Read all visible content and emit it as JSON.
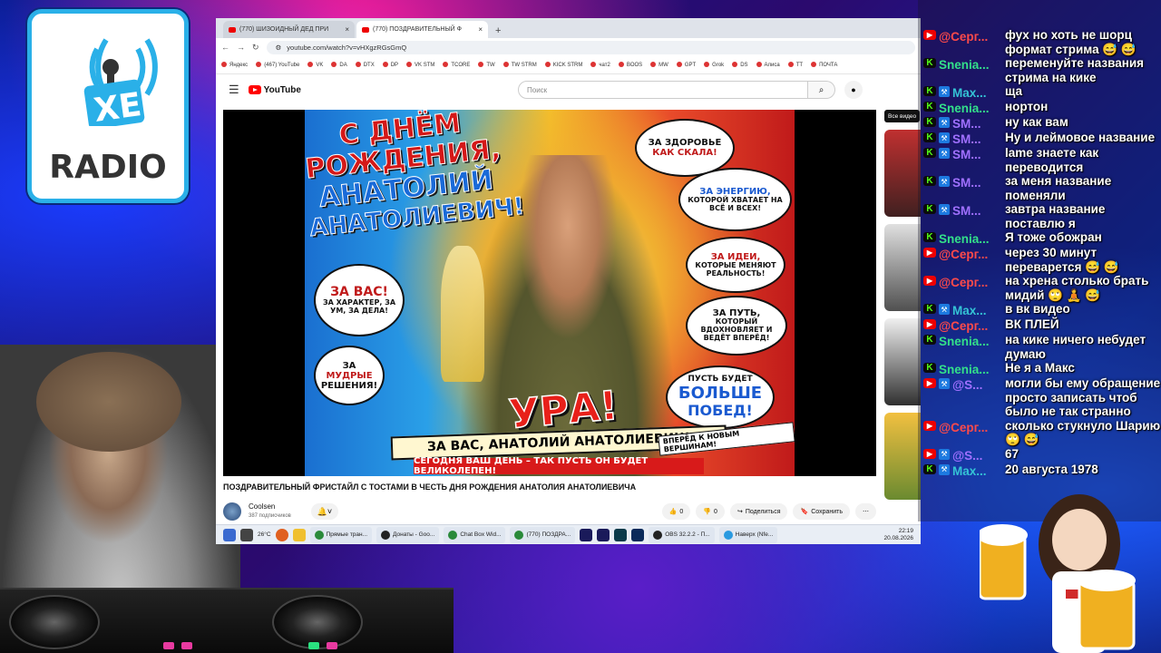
{
  "logo": {
    "text": "RADIO",
    "badge": "XE"
  },
  "browser": {
    "tabs": [
      {
        "label": "(770) ШИЗОИДНЫЙ ДЕД ПРИ"
      },
      {
        "label": "(770) ПОЗДРАВИТЕЛЬНЫЙ Ф"
      }
    ],
    "new_tab": "+",
    "url": "youtube.com/watch?v=vHXgzRGsGmQ",
    "bookmarks": [
      "Яндекс",
      "(467) YouTube",
      "VK",
      "DA",
      "DTX",
      "DP",
      "VK STM",
      "TCORE",
      "TW",
      "TW STRM",
      "KICK STRM",
      "чат2",
      "BOOS",
      "MW",
      "GPT",
      "Grok",
      "DS",
      "Алиса",
      "TT",
      "ПОЧТА"
    ],
    "yt_logo": "YouTube",
    "search_placeholder": "Поиск",
    "video_title": "ПОЗДРАВИТЕЛЬНЫЙ ФРИСТАЙЛ С ТОСТАМИ В ЧЕСТЬ ДНЯ РОЖДЕНИЯ АНАТОЛИЯ АНАТОЛИЕВИЧА",
    "channel_name": "Coolsen",
    "subscribers": "387 подписчиков",
    "likes": "0",
    "dislikes": "0",
    "share": "Поделиться",
    "save": "Сохранить",
    "sidebar_tab": "Все видео",
    "poster": {
      "title_l1": "С ДНЁМ",
      "title_l2": "РОЖДЕНИЯ,",
      "title_l3": "АНАТОЛИЙ",
      "title_l4": "АНАТОЛИЕВИЧ!",
      "b1a": "ЗА ЗДОРОВЬЕ",
      "b1b": "КАК СКАЛА!",
      "b2a": "ЗА ЭНЕРГИЮ,",
      "b2b": "КОТОРОЙ ХВАТАЕТ НА ВСЁ И ВСЕХ!",
      "b3a": "ЗА ИДЕИ,",
      "b3b": "КОТОРЫЕ МЕНЯЮТ РЕАЛЬНОСТЬ!",
      "b4a": "ЗА ПУТЬ,",
      "b4b": "КОТОРЫЙ ВДОХНОВЛЯЕТ И ВЕДЁТ ВПЕРЁД!",
      "b5a": "ЗА ВАС!",
      "b5b": "ЗА ХАРАКТЕР, ЗА УМ, ЗА ДЕЛА!",
      "b6a": "ЗА",
      "b6b": "МУДРЫЕ",
      "b6c": "РЕШЕНИЯ!",
      "b7a": "ПУСТЬ БУДЕТ",
      "b7b": "БОЛЬШЕ",
      "b7c": "ПОБЕД!",
      "ura": "УРА!",
      "banner1": "ЗА ВАС, АНАТОЛИЙ АНАТОЛИЕВИЧ!",
      "forward": "ВПЕРЁД К НОВЫМ ВЕРШИНАМ!",
      "banner2": "СЕГОДНЯ ВАШ ДЕНЬ – ТАК ПУСТЬ ОН БУДЕТ ВЕЛИКОЛЕПЕН!"
    },
    "taskbar": {
      "temp": "26°C",
      "windows": [
        "Прямые тран...",
        "Донаты - Goo...",
        "Chat Box Wid...",
        "(770) ПОЗДРА...",
        "OBS 32.2.2 - П...",
        "Наверх (Nfe..."
      ],
      "time": "22:19",
      "date": "20.08.2026"
    }
  },
  "chat": [
    {
      "platform": "yt",
      "name": "@Серг...",
      "color": "red",
      "text": "фух но хоть не шорц формат стрима 😅 😅"
    },
    {
      "platform": "kick",
      "name": "Snenia...",
      "color": "kick",
      "text": "переменуйте названия стрима на кике"
    },
    {
      "platform": "kick",
      "name": "Max...",
      "color": "kick2",
      "text": "ща"
    },
    {
      "platform": "kick",
      "name": "Snenia...",
      "color": "kick",
      "text": "нортон"
    },
    {
      "platform": "kick",
      "name": "SM...",
      "color": "pur",
      "text": "ну как вам"
    },
    {
      "platform": "kick",
      "name": "SM...",
      "color": "pur",
      "text": "Ну и леймовое название"
    },
    {
      "platform": "kick",
      "name": "SM...",
      "color": "pur",
      "text": "lame знаете как переводится"
    },
    {
      "platform": "kick",
      "name": "SM...",
      "color": "pur",
      "text": "за меня название поменяли"
    },
    {
      "platform": "kick",
      "name": "SM...",
      "color": "pur",
      "text": "завтра название поставлю я"
    },
    {
      "platform": "kick",
      "name": "Snenia...",
      "color": "kick",
      "text": "Я тоже обожран"
    },
    {
      "platform": "yt",
      "name": "@Серг...",
      "color": "red",
      "text": "через 30 минут переварется 😅 😅"
    },
    {
      "platform": "yt",
      "name": "@Серг...",
      "color": "red",
      "text": "на хрена столько брать мидий 🙄 🧘 😅"
    },
    {
      "platform": "kick",
      "name": "Max...",
      "color": "kick2",
      "text": "в вк видео"
    },
    {
      "platform": "yt",
      "name": "@Серг...",
      "color": "red",
      "text": "ВК ПЛЕЙ"
    },
    {
      "platform": "kick",
      "name": "Snenia...",
      "color": "kick",
      "text": "на кике ничего небудет думаю"
    },
    {
      "platform": "kick",
      "name": "Snenia...",
      "color": "kick",
      "text": "Не я а Макс"
    },
    {
      "platform": "yt",
      "name": "@S...",
      "color": "pur",
      "text": "могли бы ему обращение просто записать чтоб было не так странно"
    },
    {
      "platform": "yt",
      "name": "@Серг...",
      "color": "red",
      "text": "сколько стукнуло Шарию 🙄 😅"
    },
    {
      "platform": "yt",
      "name": "@S...",
      "color": "pur",
      "text": "67"
    },
    {
      "platform": "kick",
      "name": "Max...",
      "color": "kick2",
      "text": "20 августа 1978"
    }
  ],
  "colors": {
    "kick": "#53fc18",
    "youtube": "#ff0000",
    "accent_blue": "#1d7ae0"
  }
}
